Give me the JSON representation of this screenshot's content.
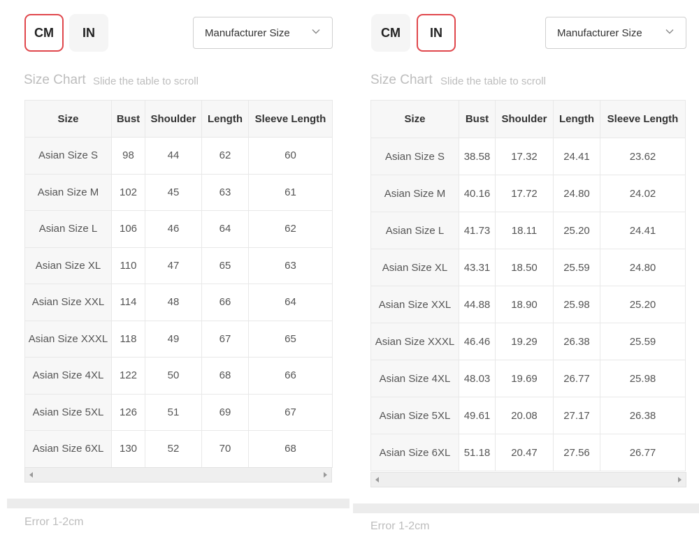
{
  "units": {
    "cm_label": "CM",
    "in_label": "IN"
  },
  "selector": {
    "label": "Manufacturer Size"
  },
  "size_chart": {
    "heading": "Size Chart",
    "hint": "Slide the table to scroll"
  },
  "table": {
    "headers": [
      "Size",
      "Bust",
      "Shoulder",
      "Length",
      "Sleeve Length"
    ],
    "sizes": [
      "Asian Size S",
      "Asian Size M",
      "Asian Size L",
      "Asian Size XL",
      "Asian Size XXL",
      "Asian Size XXXL",
      "Asian Size 4XL",
      "Asian Size 5XL",
      "Asian Size 6XL"
    ]
  },
  "panels": [
    {
      "active_unit": "CM",
      "rows": [
        [
          "98",
          "44",
          "62",
          "60"
        ],
        [
          "102",
          "45",
          "63",
          "61"
        ],
        [
          "106",
          "46",
          "64",
          "62"
        ],
        [
          "110",
          "47",
          "65",
          "63"
        ],
        [
          "114",
          "48",
          "66",
          "64"
        ],
        [
          "118",
          "49",
          "67",
          "65"
        ],
        [
          "122",
          "50",
          "68",
          "66"
        ],
        [
          "126",
          "51",
          "69",
          "67"
        ],
        [
          "130",
          "52",
          "70",
          "68"
        ]
      ]
    },
    {
      "active_unit": "IN",
      "rows": [
        [
          "38.58",
          "17.32",
          "24.41",
          "23.62"
        ],
        [
          "40.16",
          "17.72",
          "24.80",
          "24.02"
        ],
        [
          "41.73",
          "18.11",
          "25.20",
          "24.41"
        ],
        [
          "43.31",
          "18.50",
          "25.59",
          "24.80"
        ],
        [
          "44.88",
          "18.90",
          "25.98",
          "25.20"
        ],
        [
          "46.46",
          "19.29",
          "26.38",
          "25.59"
        ],
        [
          "48.03",
          "19.69",
          "26.77",
          "25.98"
        ],
        [
          "49.61",
          "20.08",
          "27.17",
          "26.38"
        ],
        [
          "51.18",
          "20.47",
          "27.56",
          "26.77"
        ]
      ]
    }
  ],
  "footer": {
    "error": "Error 1-2cm"
  },
  "colors": {
    "accent_border": "#e0474c",
    "muted_text": "#bdbdbd",
    "header_bg": "#f7f7f7"
  }
}
